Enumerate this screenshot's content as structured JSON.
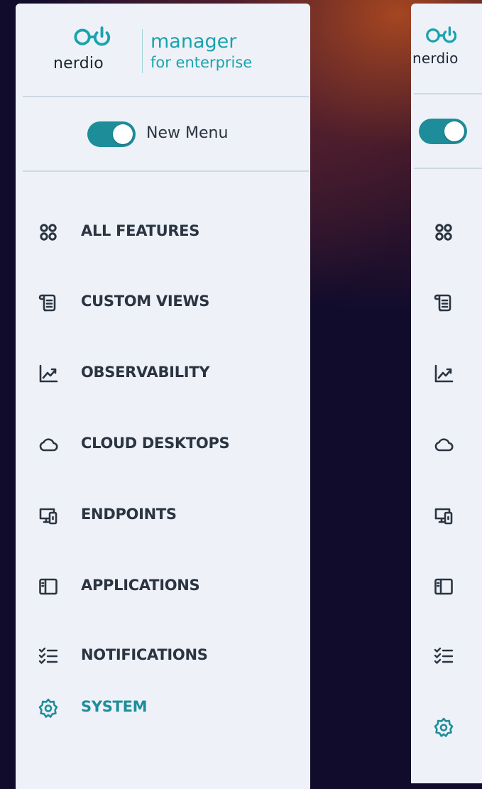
{
  "brand": {
    "name": "nerdio",
    "product_line1": "manager",
    "product_line2": "for enterprise"
  },
  "toggle": {
    "label": "New Menu",
    "state": "on"
  },
  "nav": {
    "items": [
      {
        "label": "ALL FEATURES",
        "icon": "all-features-icon"
      },
      {
        "label": "CUSTOM VIEWS",
        "icon": "scroll-list-icon"
      },
      {
        "label": "OBSERVABILITY",
        "icon": "trend-chart-icon"
      },
      {
        "label": "CLOUD DESKTOPS",
        "icon": "cloud-icon"
      },
      {
        "label": "ENDPOINTS",
        "icon": "devices-icon"
      },
      {
        "label": "APPLICATIONS",
        "icon": "sidebar-panel-icon"
      },
      {
        "label": "NOTIFICATIONS",
        "icon": "checklist-icon"
      },
      {
        "label": "SYSTEM",
        "icon": "gear-icon",
        "active": true
      }
    ]
  },
  "colors": {
    "accent": "#1d8d99",
    "logo_teal": "#1aa3ad",
    "panel_bg": "#eef2f8",
    "text": "#2b3440"
  }
}
